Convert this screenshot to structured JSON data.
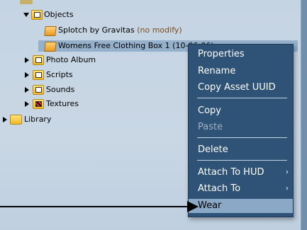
{
  "tree": {
    "objects_folder": "Objects",
    "items": [
      {
        "name": "Splotch by Gravitas",
        "suffix": "(no modify)"
      },
      {
        "name": "Womens Free Clothing Box 1 (10-06-06)"
      }
    ],
    "folders": [
      {
        "label": "Photo Album",
        "icon": "photo-album-folder-icon"
      },
      {
        "label": "Scripts",
        "icon": "scripts-folder-icon"
      },
      {
        "label": "Sounds",
        "icon": "sounds-folder-icon"
      },
      {
        "label": "Textures",
        "icon": "textures-folder-icon"
      }
    ],
    "library": "Library"
  },
  "context_menu": {
    "items": [
      {
        "label": "Properties",
        "enabled": true
      },
      {
        "label": "Rename",
        "enabled": true
      },
      {
        "label": "Copy Asset UUID",
        "enabled": true
      },
      {
        "label": "Copy",
        "enabled": true
      },
      {
        "label": "Paste",
        "enabled": false
      },
      {
        "label": "Delete",
        "enabled": true
      },
      {
        "label": "Attach To HUD",
        "enabled": true,
        "submenu": "›"
      },
      {
        "label": "Attach To",
        "enabled": true,
        "submenu": "›"
      },
      {
        "label": "Wear",
        "enabled": true,
        "highlighted": true
      }
    ]
  },
  "colors": {
    "panel_bg": "#c9d7e5",
    "menu_bg": "#2e5377",
    "highlight": "#8aa9c6",
    "selected_row": "#95b0cb"
  }
}
